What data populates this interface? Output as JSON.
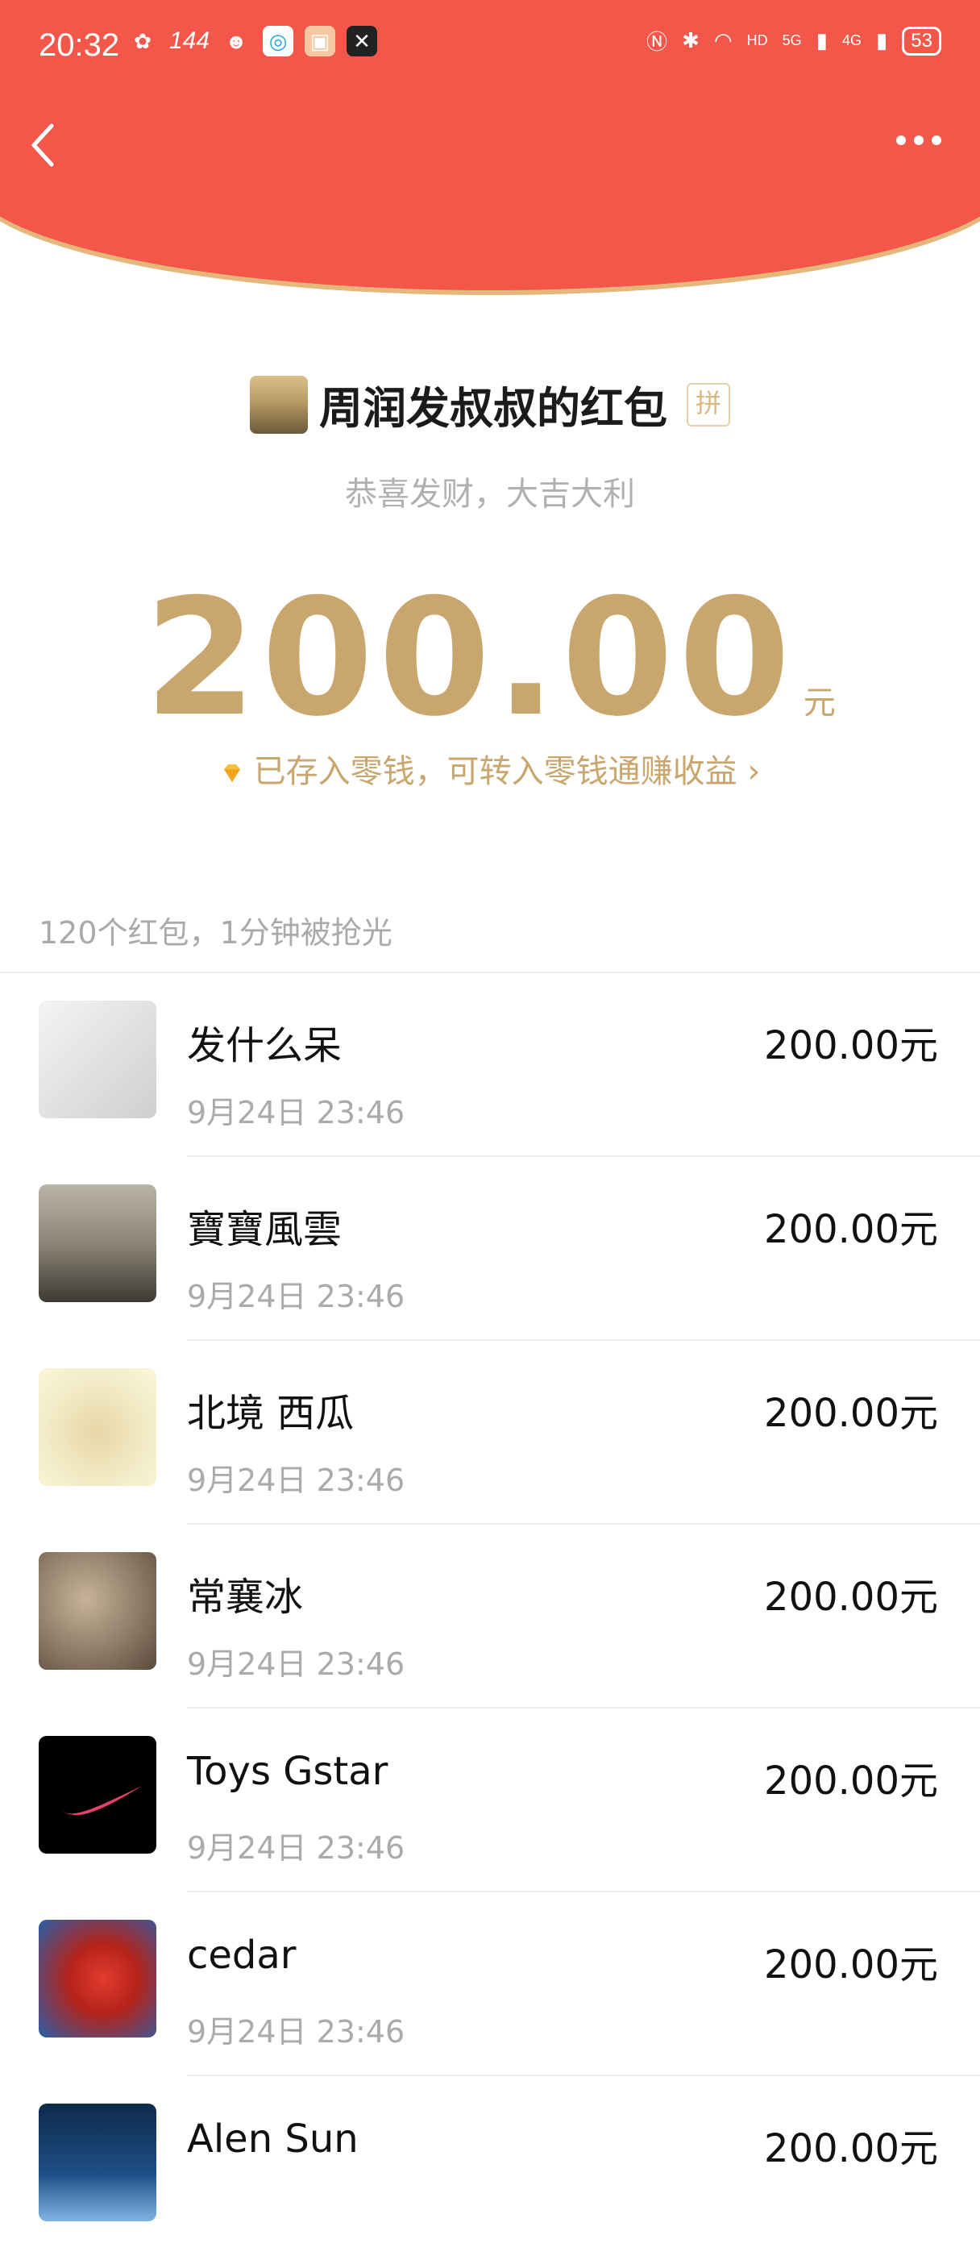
{
  "status_bar": {
    "time": "20:32",
    "refresh_rate": "144",
    "signal_5g": "5G",
    "signal_4g": "4G",
    "battery": "53"
  },
  "header": {
    "sender_name": "周润发叔叔的红包",
    "pin_label": "拼",
    "greeting": "恭喜发财，大吉大利"
  },
  "amount": {
    "value": "200.00",
    "unit": "元",
    "saved_note": "已存入零钱，可转入零钱通赚收益"
  },
  "summary": "120个红包，1分钟被抢光",
  "colors": {
    "header_red": "#F2574A",
    "gold": "#C9A66E"
  },
  "items": [
    {
      "name": "发什么呆",
      "time": "9月24日  23:46",
      "amount": "200.00元"
    },
    {
      "name": "寶寶風雲",
      "time": "9月24日  23:46",
      "amount": "200.00元"
    },
    {
      "name": "北境 西瓜",
      "time": "9月24日  23:46",
      "amount": "200.00元"
    },
    {
      "name": "常襄冰",
      "time": "9月24日  23:46",
      "amount": "200.00元"
    },
    {
      "name": "Toys Gstar",
      "time": "9月24日  23:46",
      "amount": "200.00元"
    },
    {
      "name": "cedar",
      "time": "9月24日  23:46",
      "amount": "200.00元"
    },
    {
      "name": "Alen Sun",
      "time": "",
      "amount": "200.00元"
    }
  ]
}
